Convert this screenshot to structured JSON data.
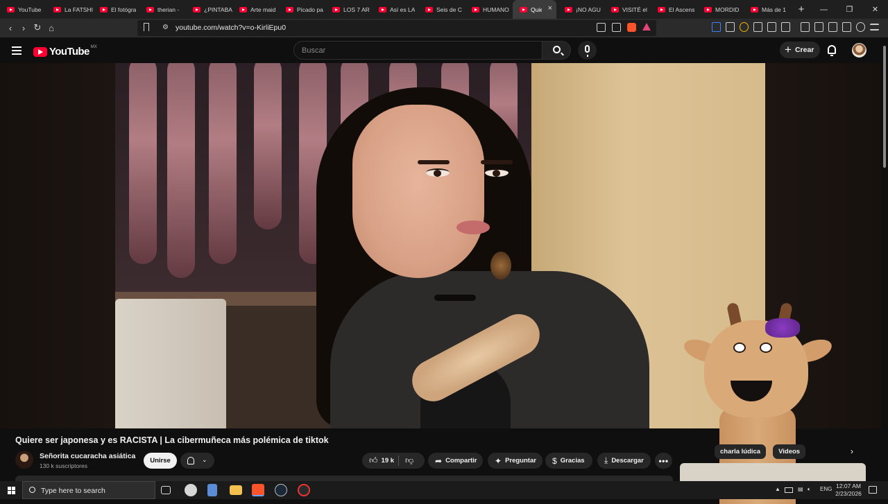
{
  "browser": {
    "tabs": [
      {
        "label": "YouTube"
      },
      {
        "label": "La FATSHI"
      },
      {
        "label": "El fotógra"
      },
      {
        "label": "therian -"
      },
      {
        "label": "¿PINTABA"
      },
      {
        "label": "Arte maid"
      },
      {
        "label": "Picado pa"
      },
      {
        "label": "LOS 7 AR"
      },
      {
        "label": "Así es LA"
      },
      {
        "label": "Seis de C"
      },
      {
        "label": "HUMANO"
      },
      {
        "label": "Quie",
        "active": true
      },
      {
        "label": "¡NO AGU"
      },
      {
        "label": "VISITÉ el"
      },
      {
        "label": "El Ascens"
      },
      {
        "label": "MORDID"
      },
      {
        "label": "Más de 1"
      }
    ],
    "new_tab_label": "+",
    "close_tab_glyph": "×",
    "url": "youtube.com/watch?v=o-KirliEpu0",
    "icons": [
      "back-icon",
      "forward-icon",
      "reload-icon",
      "home-icon",
      "bookmark-icon",
      "site-settings-icon",
      "cast-icon",
      "share-icon",
      "brave-shields-icon",
      "brave-rewards-icon",
      "extensions-icon",
      "downloads-icon",
      "media-icon",
      "sidebar-icon",
      "wallet-icon",
      "leo-icon",
      "vpn-icon",
      "menu-icon"
    ]
  },
  "youtube": {
    "logo_text": "YouTube",
    "country_code": "MX",
    "search_placeholder": "Buscar",
    "create_label": "Crear",
    "accent_color": "#ff0033"
  },
  "video": {
    "title": "Quiere ser japonesa y es RACISTA | La cibermuñeca más polémica de tiktok",
    "channel_name": "Señorita cucaracha asiática",
    "subscribers": "130 k suscriptores",
    "join_label": "Unirse",
    "likes": "19 k",
    "share_label": "Compartir",
    "ask_label": "Preguntar",
    "thanks_label": "Gracias",
    "download_label": "Descargar",
    "more_label": "•••"
  },
  "related": {
    "chips": [
      "charla lúdica",
      "Videos"
    ]
  },
  "taskbar": {
    "search_placeholder": "Type here to search",
    "language": "ENG",
    "time": "12:07 AM",
    "date": "2/23/2026"
  }
}
